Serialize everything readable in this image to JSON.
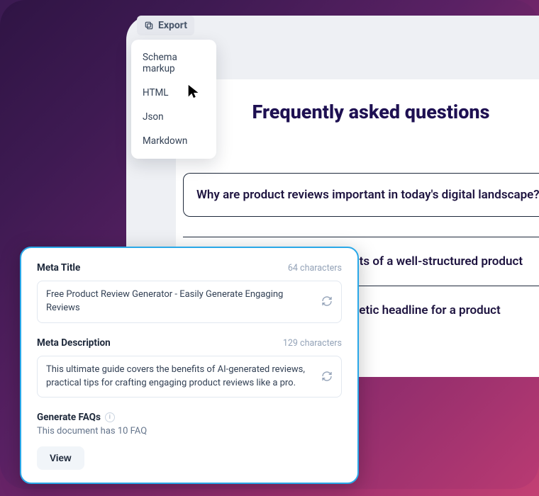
{
  "export": {
    "label": "Export",
    "items": [
      "Schema markup",
      "HTML",
      "Json",
      "Markdown"
    ]
  },
  "faq": {
    "heading": "Frequently asked questions",
    "items": [
      "Why are product reviews important in today's digital landscape?",
      "ents of a well-structured product",
      "agnetic headline for a product"
    ]
  },
  "meta": {
    "title_label": "Meta Title",
    "title_count": "64 characters",
    "title_value": "Free Product Review Generator - Easily Generate Engaging Reviews",
    "desc_label": "Meta Description",
    "desc_count": "129 characters",
    "desc_value": "This ultimate guide covers the benefits of AI-generated reviews, practical tips for crafting engaging product reviews like a pro.",
    "gen_label": "Generate FAQs",
    "gen_sub": "This document has 10 FAQ",
    "view_label": "View"
  }
}
